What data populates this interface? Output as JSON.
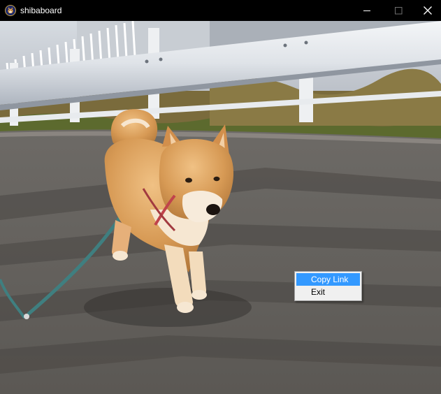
{
  "window": {
    "title": "shibaboard",
    "app_icon": "shiba-app-icon",
    "controls": {
      "minimize_icon": "minimize-icon",
      "maximize_icon": "maximize-icon",
      "close_icon": "close-icon"
    }
  },
  "content": {
    "image_subject": "shiba-inu-photo"
  },
  "context_menu": {
    "items": [
      {
        "label": "Copy Link",
        "selected": true
      },
      {
        "label": "Exit",
        "selected": false
      }
    ],
    "highlight_color": "#3399ff"
  }
}
